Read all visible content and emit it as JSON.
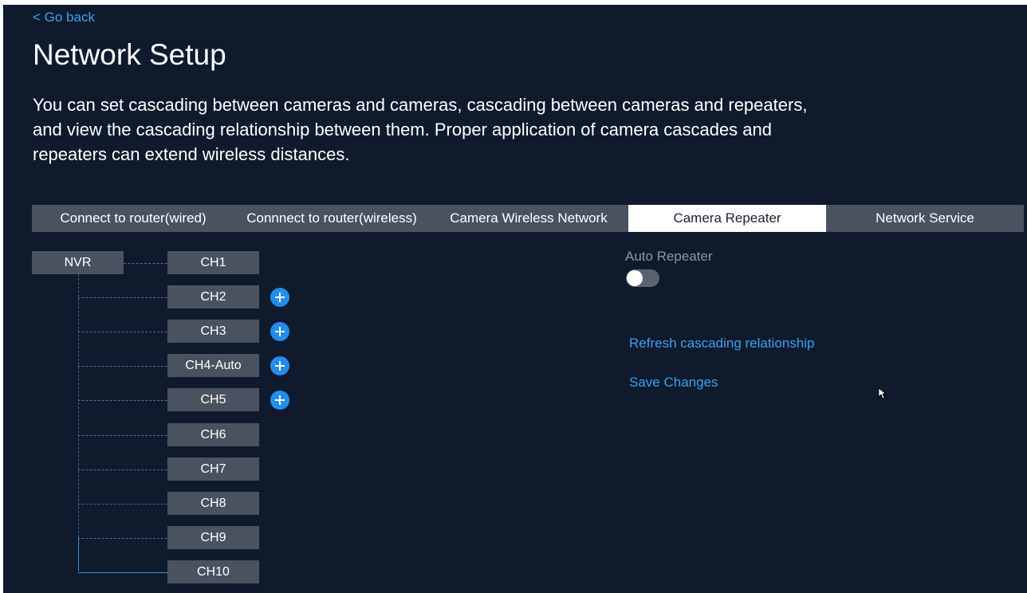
{
  "nav": {
    "back_label": "< Go back"
  },
  "page": {
    "title": "Network Setup",
    "description": "You can set cascading between cameras and cameras, cascading between cameras and repeaters, and view the cascading relationship between them. Proper application of camera cascades and repeaters can extend wireless distances."
  },
  "tabs": [
    {
      "label": "Connect to router(wired)",
      "active": false
    },
    {
      "label": "Connnect to router(wireless)",
      "active": false
    },
    {
      "label": "Camera Wireless Network",
      "active": false
    },
    {
      "label": "Camera Repeater",
      "active": true
    },
    {
      "label": "Network Service",
      "active": false
    }
  ],
  "topology": {
    "root": "NVR",
    "channels": [
      {
        "label": "CH1",
        "has_add": false
      },
      {
        "label": "CH2",
        "has_add": true
      },
      {
        "label": "CH3",
        "has_add": true
      },
      {
        "label": "CH4-Auto",
        "has_add": true
      },
      {
        "label": "CH5",
        "has_add": true
      },
      {
        "label": "CH6",
        "has_add": false
      },
      {
        "label": "CH7",
        "has_add": false
      },
      {
        "label": "CH8",
        "has_add": false
      },
      {
        "label": "CH9",
        "has_add": false
      },
      {
        "label": "CH10",
        "has_add": false
      }
    ]
  },
  "settings": {
    "auto_repeater_label": "Auto Repeater",
    "auto_repeater_on": false,
    "refresh_label": "Refresh cascading relationship",
    "save_label": "Save Changes"
  },
  "colors": {
    "background": "#0f1b2d",
    "accent": "#3aa0f0",
    "tab_bar": "#4a5260",
    "node": "#4a5260",
    "add_button": "#1e8ff0"
  }
}
